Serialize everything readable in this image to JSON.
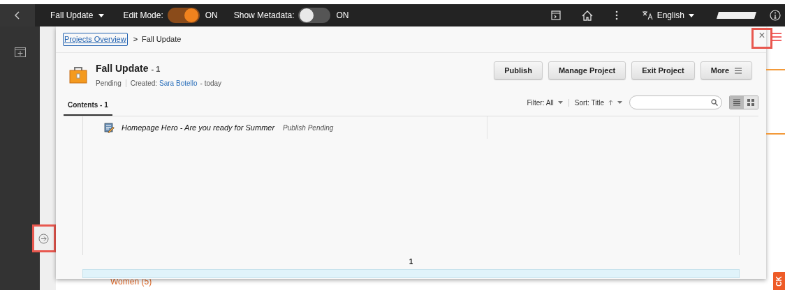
{
  "top_bar": {
    "project": "Fall Update",
    "edit_mode": {
      "label": "Edit Mode:",
      "on": true,
      "state_text": "ON"
    },
    "show_metadata": {
      "label": "Show Metadata:",
      "on": false,
      "state_text": "ON"
    },
    "language": "English"
  },
  "background": {
    "side_button_text": "CK",
    "list_item": "Women (5)"
  },
  "modal": {
    "breadcrumb": {
      "link": "Projects Overview",
      "separator": ">",
      "current": "Fall Update"
    },
    "close": "×",
    "project": {
      "title": "Fall Update",
      "count": "- 1",
      "status": "Pending",
      "created_label": "Created:",
      "author": "Sara Botello",
      "when": "- today"
    },
    "actions": [
      "Publish",
      "Manage Project",
      "Exit Project",
      "More"
    ],
    "tabs": [
      {
        "label": "Contents - 1",
        "selected": true
      }
    ],
    "filter": "Filter: All",
    "sort": "Sort: Title",
    "views": [
      {
        "kind": "list",
        "selected": true
      },
      {
        "kind": "grid",
        "selected": false
      }
    ],
    "items": [
      {
        "title": "Homepage Hero - Are you ready for Summer",
        "status": "Publish Pending"
      }
    ],
    "page": "1"
  }
}
